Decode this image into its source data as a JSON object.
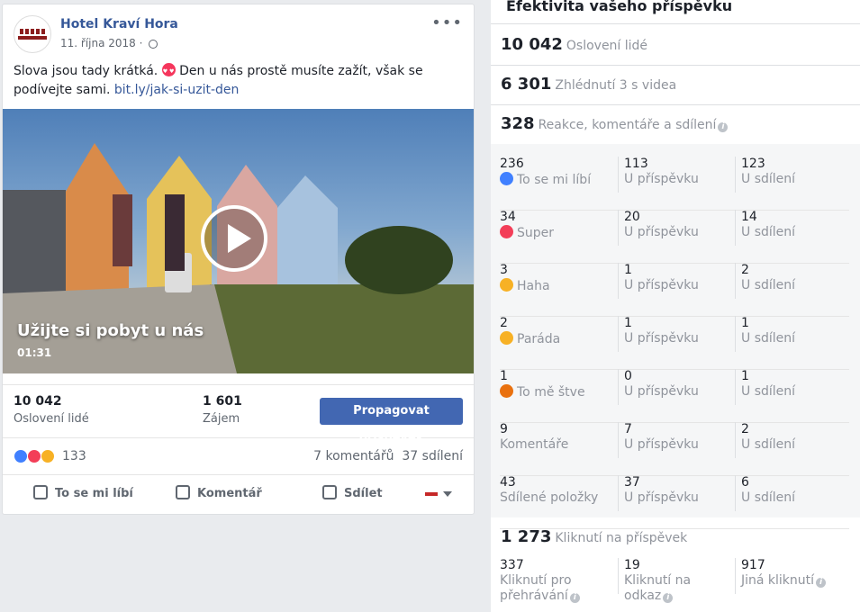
{
  "post": {
    "page_name": "Hotel Kraví Hora",
    "date": "11. října 2018",
    "text": "Slova jsou tady krátká.",
    "text_after_emoji": "Den u nás prostě musíte zažít, však se podívejte sami.",
    "link": "bit.ly/jak-si-uzit-den",
    "video": {
      "title": "Užijte si pobyt u nás",
      "duration": "01:31"
    },
    "reach": {
      "value": "10 042",
      "label": "Oslovení lidé"
    },
    "engagement": {
      "value": "1 601",
      "label": "Zájem"
    },
    "promote_label": "Propagovat příspěvek",
    "reactions_count": "133",
    "comments": "7 komentářů",
    "shares": "37 sdílení",
    "actions": {
      "like": "To se mi líbí",
      "comment": "Komentář",
      "share": "Sdílet"
    }
  },
  "panel": {
    "title": "Efektivita vašeho příspěvku",
    "reached": {
      "value": "10 042",
      "label": "Oslovení lidé"
    },
    "views": {
      "value": "6 301",
      "label": "Zhlédnutí 3 s videa"
    },
    "interactions": {
      "value": "328",
      "label": "Reakce, komentáře a sdílení"
    },
    "breakdown": [
      {
        "total": "236",
        "label": "To se mi líbí",
        "icon": "like-icon",
        "post": "113",
        "shared": "123"
      },
      {
        "total": "34",
        "label": "Super",
        "icon": "love-icon",
        "post": "20",
        "shared": "14"
      },
      {
        "total": "3",
        "label": "Haha",
        "icon": "haha-icon",
        "post": "1",
        "shared": "2"
      },
      {
        "total": "2",
        "label": "Paráda",
        "icon": "wow-icon",
        "post": "1",
        "shared": "1"
      },
      {
        "total": "1",
        "label": "To mě štve",
        "icon": "angry-icon",
        "post": "0",
        "shared": "1"
      },
      {
        "total": "9",
        "label": "Komentáře",
        "icon": "",
        "post": "7",
        "shared": "2"
      },
      {
        "total": "43",
        "label": "Sdílené položky",
        "icon": "",
        "post": "37",
        "shared": "6"
      }
    ],
    "col_post": "U příspěvku",
    "col_shared": "U sdílení",
    "clicks": {
      "value": "1 273",
      "label": "Kliknutí na příspěvek"
    },
    "click_breakdown": [
      {
        "value": "337",
        "label": "Kliknutí pro přehrávání"
      },
      {
        "value": "19",
        "label": "Kliknutí na odkaz"
      },
      {
        "value": "917",
        "label": "Jiná kliknutí"
      }
    ]
  }
}
